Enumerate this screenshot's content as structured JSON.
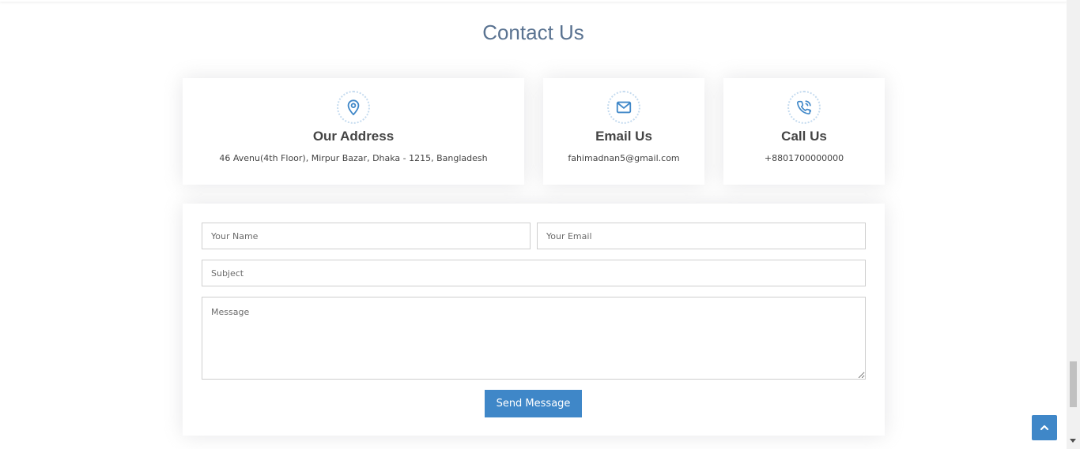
{
  "section": {
    "title": "Contact Us"
  },
  "info_boxes": [
    {
      "icon": "map-pin-icon",
      "title": "Our Address",
      "text": "46 Avenu(4th Floor), Mirpur Bazar, Dhaka - 1215, Bangladesh"
    },
    {
      "icon": "envelope-icon",
      "title": "Email Us",
      "text": "fahimadnan5@gmail.com"
    },
    {
      "icon": "phone-call-icon",
      "title": "Call Us",
      "text": "+8801700000000"
    }
  ],
  "form": {
    "name_placeholder": "Your Name",
    "email_placeholder": "Your Email",
    "subject_placeholder": "Subject",
    "message_placeholder": "Message",
    "submit_label": "Send Message"
  },
  "back_to_top": {
    "icon": "chevron-up-icon"
  },
  "colors": {
    "accent": "#3f87c8",
    "title": "#5a7391",
    "text": "#444444"
  }
}
